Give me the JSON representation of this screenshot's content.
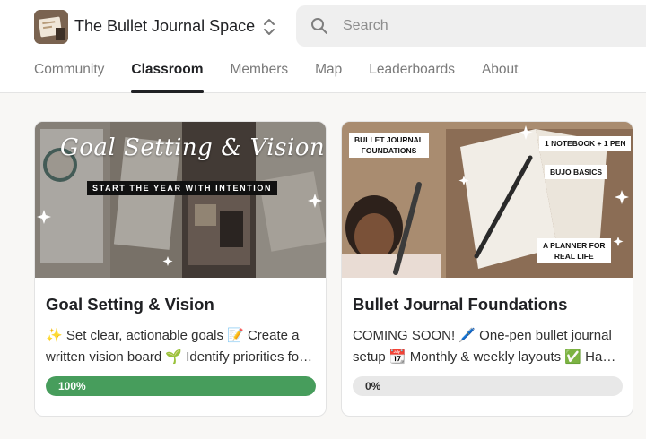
{
  "group": {
    "title": "The Bullet Journal Space",
    "logo_icon": "journal-logo"
  },
  "search": {
    "placeholder": "Search",
    "value": ""
  },
  "tabs": [
    {
      "label": "Community",
      "active": false
    },
    {
      "label": "Classroom",
      "active": true
    },
    {
      "label": "Members",
      "active": false
    },
    {
      "label": "Map",
      "active": false
    },
    {
      "label": "Leaderboards",
      "active": false
    },
    {
      "label": "About",
      "active": false
    }
  ],
  "courses": [
    {
      "title": "Goal Setting & Vision",
      "description": "✨ Set clear, actionable goals 📝 Create a written vision board 🌱 Identify priorities for the year ahead",
      "progress_label": "100%",
      "progress": 1.0,
      "image": {
        "headline": "Goal Setting & Vision",
        "banner": "START THE YEAR WITH INTENTION"
      }
    },
    {
      "title": "Bullet Journal Foundations",
      "description": "COMING SOON! 🖊️ One-pen bullet journal setup 📆 Monthly & weekly layouts ✅ Habit trackers",
      "progress_label": "0%",
      "progress": 0.0,
      "image": {
        "tag_foundations": "BULLET JOURNAL\nFOUNDATIONS",
        "tag_notebook": "1 NOTEBOOK + 1 PEN",
        "tag_basics": "BUJO BASICS",
        "tag_planner": "A PLANNER FOR\nREAL LIFE"
      }
    }
  ],
  "colors": {
    "progress_complete": "#479d5c",
    "progress_track": "#e8e8e8",
    "active_tab": "#202124"
  }
}
